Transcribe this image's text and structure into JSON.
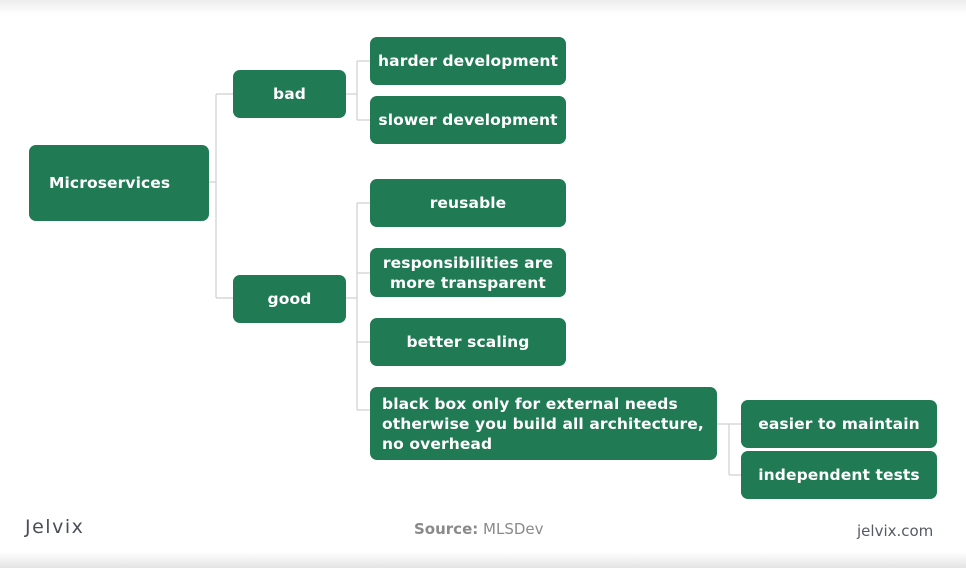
{
  "diagram": {
    "type": "tree",
    "root": {
      "label": "Microservices",
      "children": [
        {
          "label": "bad",
          "children": [
            {
              "label": "harder development"
            },
            {
              "label": "slower development"
            }
          ]
        },
        {
          "label": "good",
          "children": [
            {
              "label": "reusable"
            },
            {
              "label": "responsibilities are more transparent"
            },
            {
              "label": "better scaling"
            },
            {
              "label": "black box only for external needs otherwise you build all architecture, no overhead",
              "children": [
                {
                  "label": "easier to maintain"
                },
                {
                  "label": "independent tests"
                }
              ]
            }
          ]
        }
      ]
    },
    "colors": {
      "node_fill": "#207a53",
      "node_text": "#ffffff",
      "connector": "#cfcfcf"
    }
  },
  "footer": {
    "brand": "Jelvix",
    "source_label": "Source:",
    "source_value": "MLSDev",
    "url": "jelvix.com"
  }
}
